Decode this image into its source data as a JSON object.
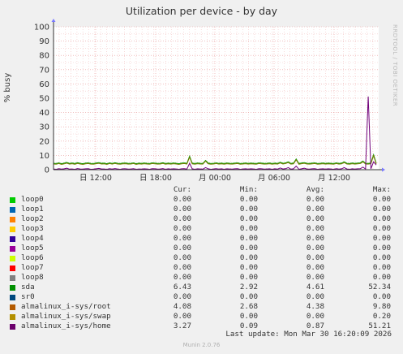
{
  "chart_data": {
    "type": "line",
    "title": "Utilization per device - by day",
    "ylabel": "% busy",
    "ylim": [
      0,
      100
    ],
    "yticks": [
      0,
      10,
      20,
      30,
      40,
      50,
      60,
      70,
      80,
      90,
      100
    ],
    "xticks": [
      "日 12:00",
      "日 18:00",
      "月 00:00",
      "月 06:00",
      "月 12:00"
    ],
    "grid": true,
    "series": [
      {
        "name": "sda",
        "color": "#00a000",
        "values": [
          4.5,
          4.3,
          4.8,
          4.2,
          4.6,
          5.1,
          4.4,
          4.7,
          4.3,
          4.9,
          4.5,
          4.2,
          4.6,
          4.8,
          4.4,
          4.3,
          4.7,
          5.0,
          4.5,
          4.6,
          4.2,
          4.8,
          4.4,
          4.9,
          4.5,
          4.3,
          4.6,
          4.7,
          4.4,
          4.5,
          4.8,
          4.2,
          4.6,
          4.4,
          4.7,
          4.5,
          4.3,
          4.8,
          4.6,
          4.4,
          4.5,
          4.9,
          4.3,
          4.6,
          4.4,
          4.7,
          4.5,
          4.2,
          4.6,
          4.8,
          4.4,
          9.5,
          4.6,
          4.3,
          4.7,
          4.5,
          4.4,
          6.5,
          4.6,
          4.3,
          4.5,
          4.8,
          4.4,
          4.6,
          4.3,
          4.7,
          4.5,
          4.4,
          4.6,
          4.8,
          4.3,
          4.5,
          4.7,
          4.4,
          4.6,
          4.5,
          4.3,
          4.8,
          4.6,
          4.4,
          4.5,
          4.7,
          4.3,
          4.6,
          4.4,
          5.2,
          4.5,
          4.8,
          5.5,
          4.4,
          4.6,
          7.5,
          4.3,
          4.7,
          5.0,
          4.5,
          4.4,
          4.6,
          4.8,
          4.3,
          4.5,
          4.7,
          4.4,
          4.6,
          4.5,
          4.3,
          4.8,
          4.4,
          4.6,
          5.5,
          4.5,
          4.3,
          4.7,
          4.4,
          4.6,
          4.8,
          6.0,
          4.5,
          4.4,
          4.7,
          10.5,
          4.6
        ]
      },
      {
        "name": "almalinux_i-sys/root",
        "color": "#7a7a00",
        "values": [
          4.0,
          3.8,
          4.3,
          3.7,
          4.1,
          4.6,
          3.9,
          4.2,
          3.8,
          4.4,
          4.0,
          3.7,
          4.1,
          4.3,
          3.9,
          3.8,
          4.2,
          4.5,
          4.0,
          4.1,
          3.7,
          4.3,
          3.9,
          4.4,
          4.0,
          3.8,
          4.1,
          4.2,
          3.9,
          4.0,
          4.3,
          3.7,
          4.1,
          3.9,
          4.2,
          4.0,
          3.8,
          4.3,
          4.1,
          3.9,
          4.0,
          4.4,
          3.8,
          4.1,
          3.9,
          4.2,
          4.0,
          3.7,
          4.1,
          4.3,
          3.9,
          8.8,
          4.1,
          3.8,
          4.2,
          4.0,
          3.9,
          6.0,
          4.1,
          3.8,
          4.0,
          4.3,
          3.9,
          4.1,
          3.8,
          4.2,
          4.0,
          3.9,
          4.1,
          4.3,
          3.8,
          4.0,
          4.2,
          3.9,
          4.1,
          4.0,
          3.8,
          4.3,
          4.1,
          3.9,
          4.0,
          4.2,
          3.8,
          4.1,
          3.9,
          4.7,
          4.0,
          4.3,
          5.0,
          3.9,
          4.1,
          7.0,
          3.8,
          4.2,
          4.5,
          4.0,
          3.9,
          4.1,
          4.3,
          3.8,
          4.0,
          4.2,
          3.9,
          4.1,
          4.0,
          3.8,
          4.3,
          3.9,
          4.1,
          5.0,
          4.0,
          3.8,
          4.2,
          3.9,
          4.1,
          4.3,
          5.5,
          4.0,
          3.9,
          4.2,
          9.8,
          4.1
        ]
      },
      {
        "name": "almalinux_i-sys/home",
        "color": "#70007a",
        "values": [
          0.5,
          0.3,
          0.7,
          0.4,
          0.6,
          1.0,
          0.4,
          0.5,
          0.3,
          0.8,
          0.5,
          0.4,
          0.6,
          0.7,
          0.3,
          0.4,
          0.6,
          0.9,
          0.5,
          0.5,
          0.3,
          0.7,
          0.4,
          0.8,
          0.5,
          0.3,
          0.6,
          0.6,
          0.4,
          0.5,
          0.7,
          0.3,
          0.5,
          0.4,
          0.6,
          0.5,
          0.3,
          0.7,
          0.6,
          0.4,
          0.5,
          0.8,
          0.3,
          0.6,
          0.4,
          0.6,
          0.5,
          0.3,
          0.6,
          0.7,
          0.4,
          4.5,
          0.6,
          0.3,
          0.6,
          0.5,
          0.4,
          1.5,
          0.6,
          0.3,
          0.5,
          0.7,
          0.4,
          0.6,
          0.3,
          0.6,
          0.5,
          0.4,
          0.6,
          0.7,
          0.3,
          0.5,
          0.6,
          0.4,
          0.6,
          0.5,
          0.3,
          0.7,
          0.6,
          0.4,
          0.5,
          0.6,
          0.3,
          0.6,
          0.4,
          1.2,
          0.5,
          0.7,
          1.5,
          0.4,
          0.6,
          2.5,
          0.3,
          0.6,
          1.0,
          0.5,
          0.4,
          0.6,
          0.7,
          0.3,
          0.5,
          0.6,
          0.4,
          0.6,
          0.5,
          0.3,
          0.7,
          0.4,
          0.6,
          1.5,
          0.5,
          0.3,
          0.6,
          0.4,
          0.6,
          0.7,
          1.8,
          0.5,
          51.21,
          0.6,
          5.5,
          3.27
        ]
      }
    ]
  },
  "legend": {
    "headers": [
      "Cur:",
      "Min:",
      "Avg:",
      "Max:"
    ],
    "rows": [
      {
        "name": "loop0",
        "color": "#00cc00",
        "cur": "0.00",
        "min": "0.00",
        "avg": "0.00",
        "max": "0.00"
      },
      {
        "name": "loop1",
        "color": "#0066b3",
        "cur": "0.00",
        "min": "0.00",
        "avg": "0.00",
        "max": "0.00"
      },
      {
        "name": "loop2",
        "color": "#ff8000",
        "cur": "0.00",
        "min": "0.00",
        "avg": "0.00",
        "max": "0.00"
      },
      {
        "name": "loop3",
        "color": "#ffcc00",
        "cur": "0.00",
        "min": "0.00",
        "avg": "0.00",
        "max": "0.00"
      },
      {
        "name": "loop4",
        "color": "#330099",
        "cur": "0.00",
        "min": "0.00",
        "avg": "0.00",
        "max": "0.00"
      },
      {
        "name": "loop5",
        "color": "#990099",
        "cur": "0.00",
        "min": "0.00",
        "avg": "0.00",
        "max": "0.00"
      },
      {
        "name": "loop6",
        "color": "#ccff00",
        "cur": "0.00",
        "min": "0.00",
        "avg": "0.00",
        "max": "0.00"
      },
      {
        "name": "loop7",
        "color": "#ff0000",
        "cur": "0.00",
        "min": "0.00",
        "avg": "0.00",
        "max": "0.00"
      },
      {
        "name": "loop8",
        "color": "#808080",
        "cur": "0.00",
        "min": "0.00",
        "avg": "0.00",
        "max": "0.00"
      },
      {
        "name": "sda",
        "color": "#008f00",
        "cur": "6.43",
        "min": "2.92",
        "avg": "4.61",
        "max": "52.34"
      },
      {
        "name": "sr0",
        "color": "#00487d",
        "cur": "0.00",
        "min": "0.00",
        "avg": "0.00",
        "max": "0.00"
      },
      {
        "name": "almalinux_i-sys/root",
        "color": "#b35a00",
        "cur": "4.08",
        "min": "2.68",
        "avg": "4.38",
        "max": "9.80"
      },
      {
        "name": "almalinux_i-sys/swap",
        "color": "#b38f00",
        "cur": "0.00",
        "min": "0.00",
        "avg": "0.00",
        "max": "0.20"
      },
      {
        "name": "almalinux_i-sys/home",
        "color": "#6b006b",
        "cur": "3.27",
        "min": "0.09",
        "avg": "0.87",
        "max": "51.21"
      }
    ]
  },
  "watermark": "RRDTOOL / TOBI OETIKER",
  "last_update": "Last update: Mon Mar 30 16:20:09 2026",
  "version": "Munin 2.0.76"
}
